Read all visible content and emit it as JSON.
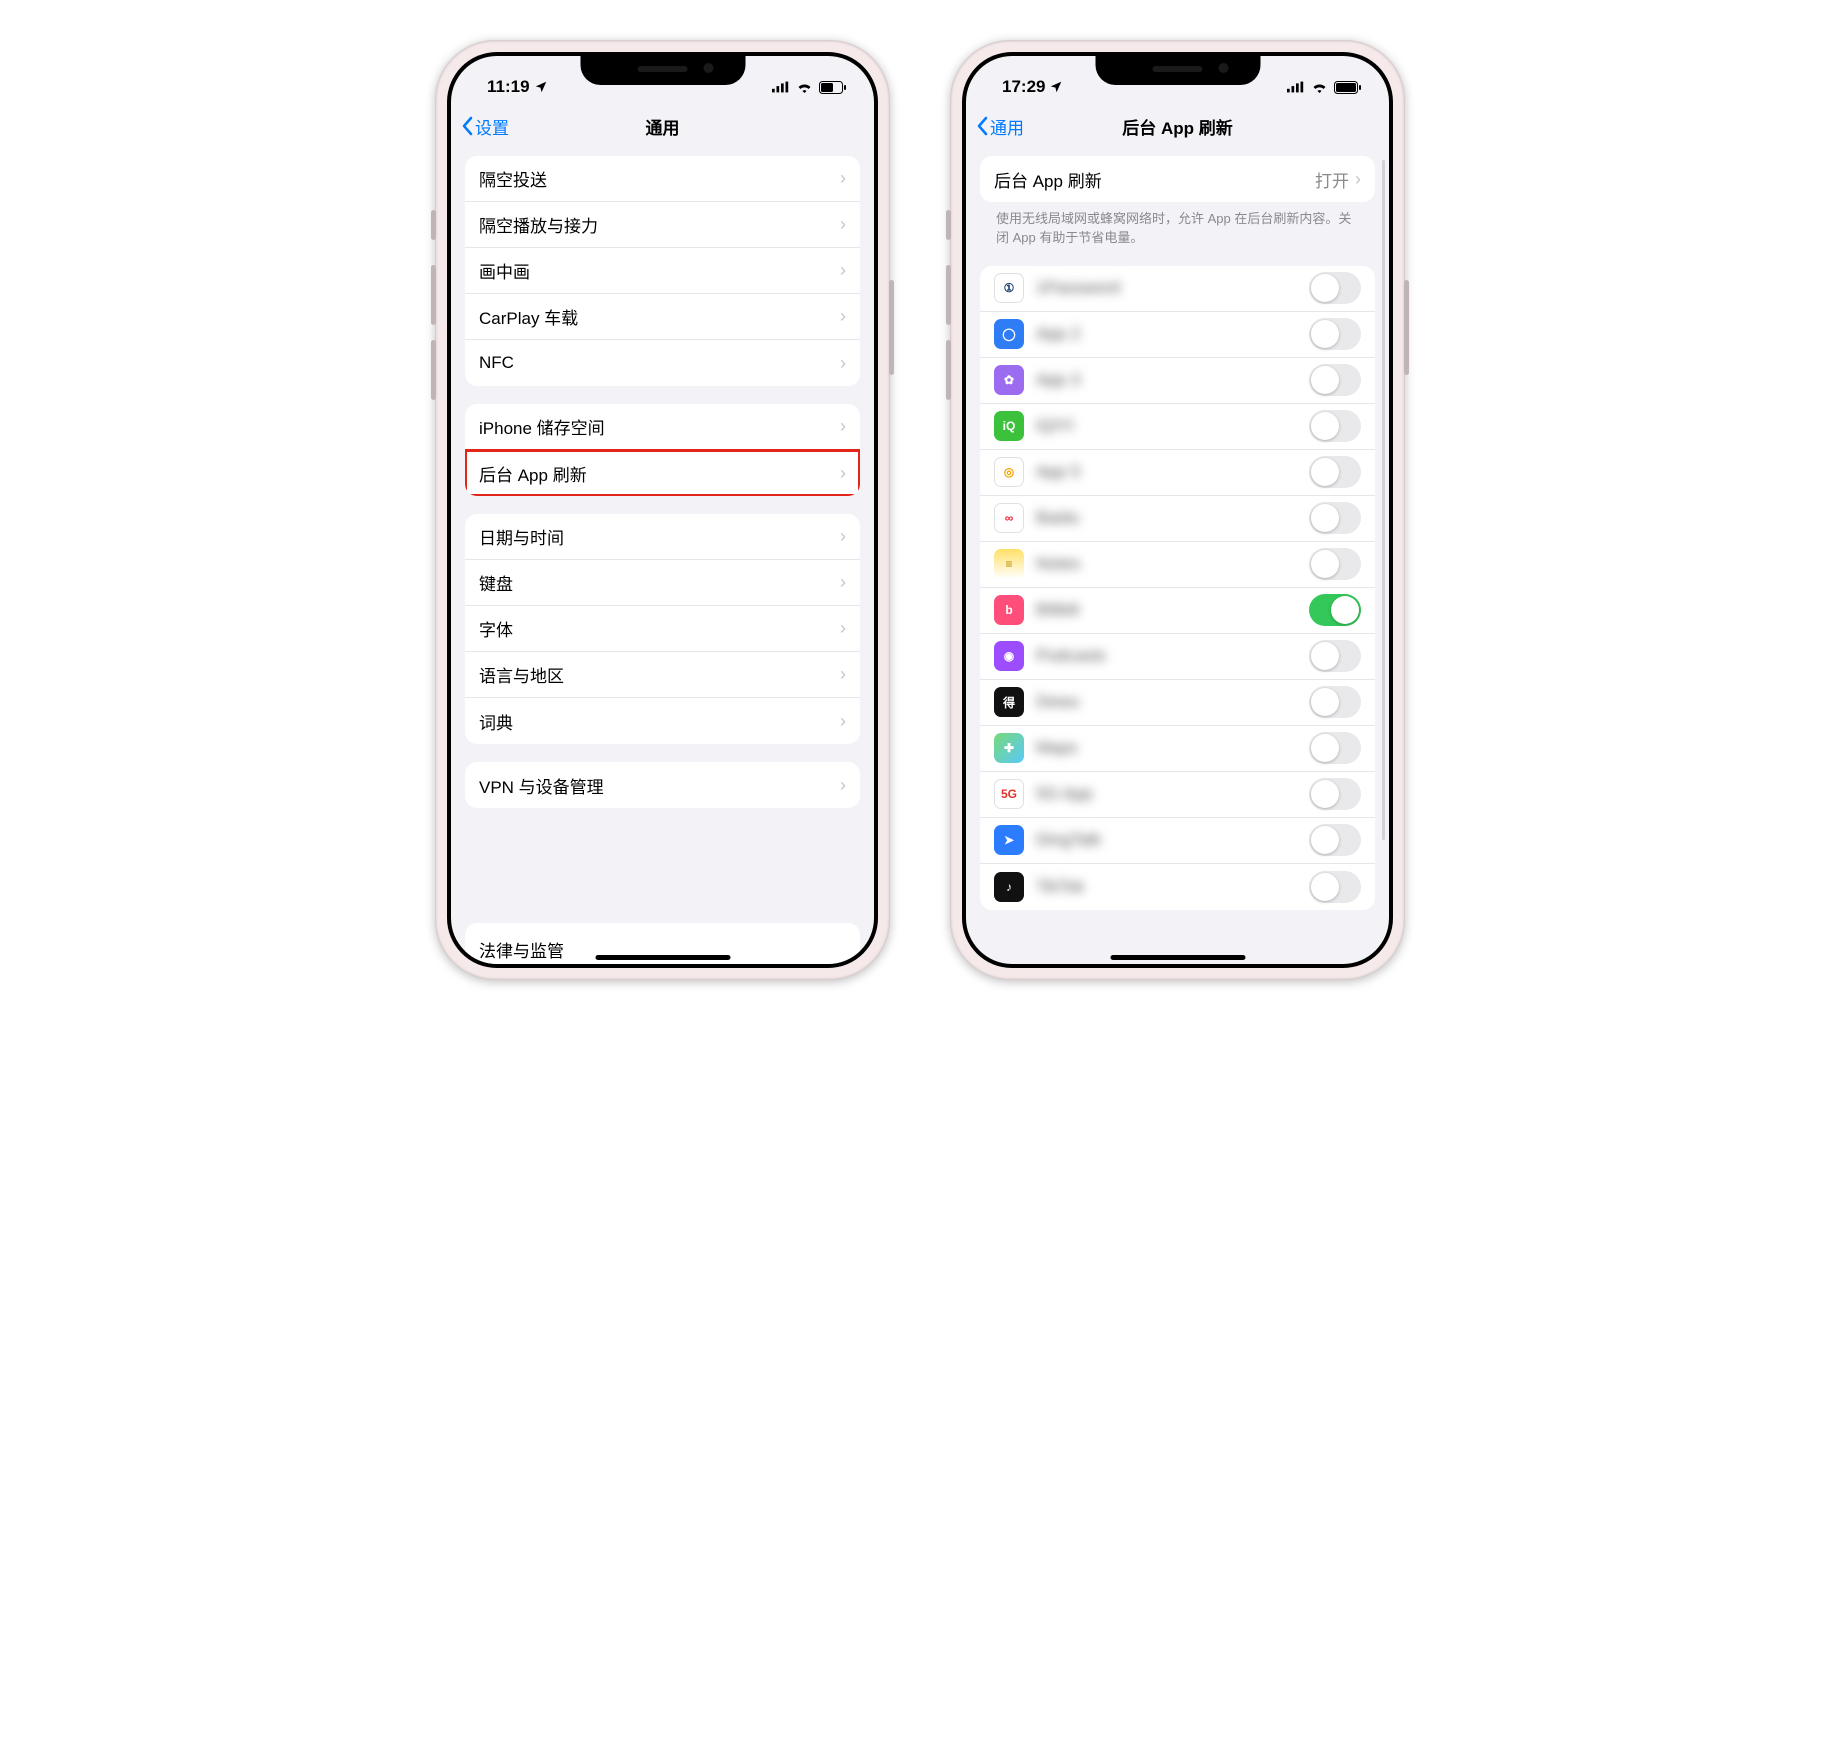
{
  "left": {
    "status": {
      "time": "11:19",
      "location_arrow": true,
      "battery_level": "half"
    },
    "nav": {
      "back_label": "设置",
      "title": "通用"
    },
    "groups": [
      {
        "rows": [
          {
            "label": "隔空投送"
          },
          {
            "label": "隔空播放与接力"
          },
          {
            "label": "画中画"
          },
          {
            "label": "CarPlay 车载"
          },
          {
            "label": "NFC"
          }
        ]
      },
      {
        "rows": [
          {
            "label": "iPhone 储存空间"
          },
          {
            "label": "后台 App 刷新",
            "highlight": true
          }
        ]
      },
      {
        "rows": [
          {
            "label": "日期与时间"
          },
          {
            "label": "键盘"
          },
          {
            "label": "字体"
          },
          {
            "label": "语言与地区"
          },
          {
            "label": "词典"
          }
        ]
      },
      {
        "rows": [
          {
            "label": "VPN 与设备管理"
          }
        ]
      }
    ],
    "cutoff_label": "法律与监管"
  },
  "right": {
    "status": {
      "time": "17:29",
      "location_arrow": true,
      "battery_level": "full"
    },
    "nav": {
      "back_label": "通用",
      "title": "后台 App 刷新"
    },
    "master": {
      "label": "后台 App 刷新",
      "value": "打开"
    },
    "footer": "使用无线局域网或蜂窝网络时，允许 App 在后台刷新内容。关闭 App 有助于节省电量。",
    "apps": [
      {
        "name": "1Password",
        "on": false,
        "icon_bg": "#ffffff",
        "icon_fg": "#1a3b6e",
        "icon_txt": "①"
      },
      {
        "name": "App 2",
        "on": false,
        "icon_bg": "#2f7df6",
        "icon_txt": "◯"
      },
      {
        "name": "App 3",
        "on": false,
        "icon_bg": "#9b6cf0",
        "icon_txt": "✿"
      },
      {
        "name": "iQIYI",
        "on": false,
        "icon_bg": "#3cc13c",
        "icon_txt": "iQ"
      },
      {
        "name": "App 5",
        "on": false,
        "icon_bg": "#ffffff",
        "icon_fg": "#f7a400",
        "icon_txt": "◎"
      },
      {
        "name": "Baidu",
        "on": false,
        "icon_bg": "#ffffff",
        "icon_fg": "#e23",
        "icon_txt": "∞"
      },
      {
        "name": "Notes",
        "on": false,
        "icon_bg": "linear-gradient(#ffe066,#fff)",
        "icon_fg": "#b58900",
        "icon_txt": "≡"
      },
      {
        "name": "Bilibili",
        "on": true,
        "icon_bg": "#ff4e7a",
        "icon_txt": "b"
      },
      {
        "name": "Podcasts",
        "on": false,
        "icon_bg": "#9b4dff",
        "icon_txt": "◉"
      },
      {
        "name": "Dewu",
        "on": false,
        "icon_bg": "#111111",
        "icon_txt": "得"
      },
      {
        "name": "Maps",
        "on": false,
        "icon_bg": "linear-gradient(135deg,#77d977,#5ac8fa)",
        "icon_txt": "✚"
      },
      {
        "name": "5G App",
        "on": false,
        "icon_bg": "#ffffff",
        "icon_fg": "#e2332a",
        "icon_txt": "5G"
      },
      {
        "name": "DingTalk",
        "on": false,
        "icon_bg": "#2b7cff",
        "icon_txt": "➤"
      },
      {
        "name": "TikTok",
        "on": false,
        "icon_bg": "#111111",
        "icon_txt": "♪"
      }
    ]
  }
}
